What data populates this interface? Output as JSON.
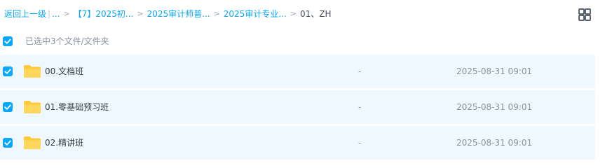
{
  "breadcrumb": {
    "back_label": "返回上一级",
    "separator": "|",
    "ellipsis": "...",
    "items": [
      "【7】2025初...",
      "2025审计师普...",
      "2025审计专业..."
    ],
    "current": "01、ZH"
  },
  "toolbar": {
    "view_toggle_icon": "grid-view-icon"
  },
  "selection": {
    "label": "已选中3个文件/文件夹",
    "checked": true
  },
  "files": [
    {
      "name": "00.文档班",
      "size": "-",
      "modified": "2025-08-31 09:01",
      "checked": true,
      "icon": "folder-icon"
    },
    {
      "name": "01.零基础预习班",
      "size": "-",
      "modified": "2025-08-31 09:01",
      "checked": true,
      "icon": "folder-icon"
    },
    {
      "name": "02.精讲班",
      "size": "-",
      "modified": "2025-08-31 09:01",
      "checked": true,
      "icon": "folder-icon"
    }
  ],
  "colors": {
    "accent": "#06a7ff",
    "row_selected_bg": "#f0f8ff",
    "folder": "#ffc93a"
  }
}
